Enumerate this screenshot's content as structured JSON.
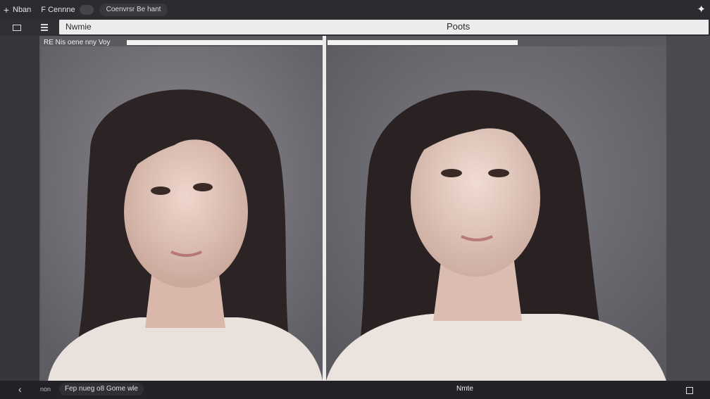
{
  "titlebar": {
    "title_a": "Nban",
    "title_b": "F Cennne",
    "pill_label": "Coenvrsr Be hant"
  },
  "toolbar": {
    "address_left": "Nwmie",
    "address_center": "Poots"
  },
  "content": {
    "label": "RE Nis oene nny Voy"
  },
  "bottombar": {
    "small_label": "non",
    "pill_label": "Fep nueg o8 Gome wle",
    "center_label": "Nmte"
  },
  "icons": [
    "plus-icon",
    "sparkle-icon",
    "window-icon",
    "menu-icon",
    "chevron-left-icon",
    "square-icon"
  ]
}
